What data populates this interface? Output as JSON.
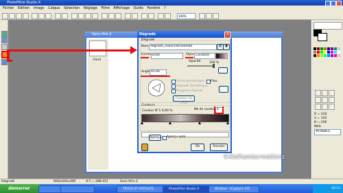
{
  "app": {
    "title": "PhotoFiltre Studio X"
  },
  "menu": [
    "Fichier",
    "Edition",
    "Image",
    "Calque",
    "Sélection",
    "Réglage",
    "Filtre",
    "Affichage",
    "Outils",
    "Fenêtre",
    "?"
  ],
  "toolbar": {
    "zoom": "100%"
  },
  "document": {
    "title": "Sans titre 2",
    "layer": "Fond"
  },
  "dialog": {
    "title": "Dégradé",
    "section_gradient": "Dégradé",
    "name_label": "Nom",
    "name_value": "degrade_indiannetcolombe",
    "forme_label": "Forme",
    "forme_value": "Droit",
    "style_label": "Style",
    "style_value": "Constant",
    "opacity_label": "Opacité",
    "opacity_value": "100 %",
    "angle_label": "Angle",
    "angle_value": "45.00",
    "forme_sym": "Forme Symétrique",
    "degrade_sym": "Dégradé Symétrique",
    "polygone": "Polygone régulier",
    "flou": "Flou",
    "couleur_fond": "Couleur de Fond",
    "section_colors": "Couleurs",
    "couleur_n": "Couleur N°1 0,00 %",
    "nb_couleurs_label": "Nb de couleurs",
    "nb_couleurs_value": "4",
    "apercu_btn": "Aperçu",
    "apercu_auto": "Aperçu auto",
    "ok_btn": "Ok",
    "cancel_btn": "Annuler"
  },
  "right": {
    "r": "R = 234",
    "g": "V = 155",
    "b": "B = 206",
    "hex_label": "Web",
    "hex": "#E9BBCE"
  },
  "status": {
    "left": "Dégradé",
    "dims": "600x500x16M",
    "coords": "X:Y = 288:451",
    "doc": "Sans titre 2"
  },
  "taskbar": {
    "start": "démarrer",
    "tasks": [
      "",
      "",
      "TRUCS ET ASTUCES...",
      "PhotoFiltre Studio X",
      "Window - [Capture-13]"
    ],
    "clock": "20:15"
  },
  "watermark": "©Kathaniacreations",
  "colors": {
    "accent": "#245edc",
    "highlight": "#e21010"
  }
}
